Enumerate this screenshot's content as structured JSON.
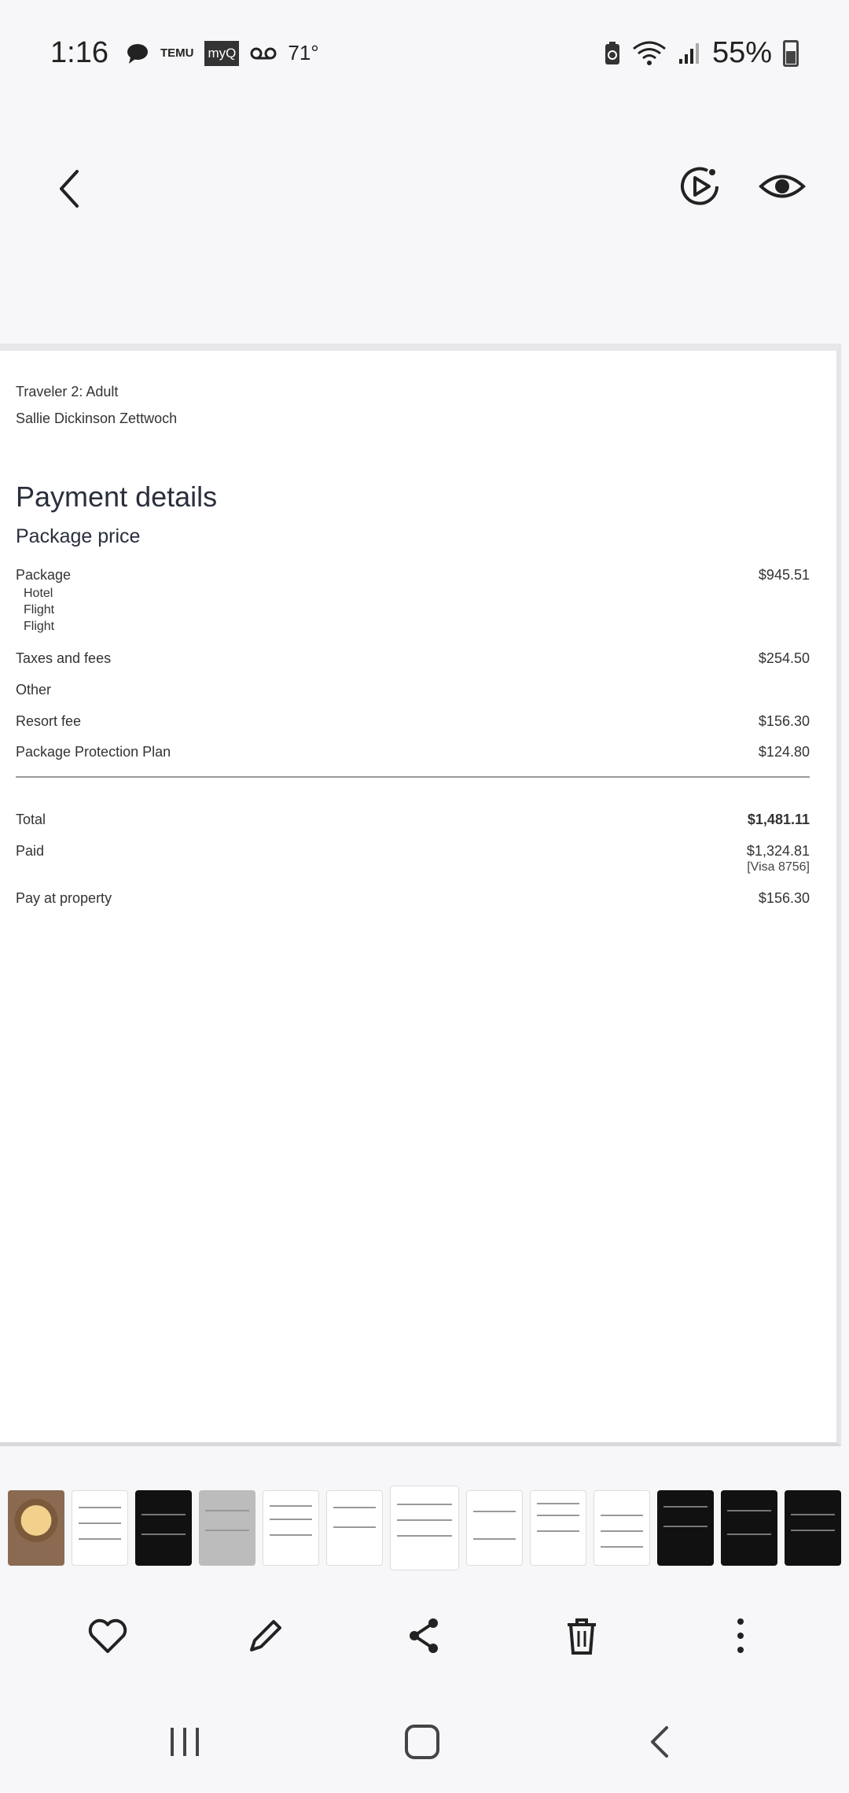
{
  "status_bar": {
    "time": "1:16",
    "temu_label": "TEMU",
    "myq_label": "myQ",
    "temperature": "71°",
    "battery_percent": "55%"
  },
  "document": {
    "traveler_heading": "Traveler 2: Adult",
    "traveler_name": "Sallie Dickinson Zettwoch",
    "payment_title": "Payment details",
    "package_title": "Package price",
    "package": {
      "label": "Package",
      "amount": "$945.51",
      "items": [
        "Hotel",
        "Flight",
        "Flight"
      ]
    },
    "taxes": {
      "label": "Taxes and fees",
      "amount": "$254.50"
    },
    "other": {
      "label": "Other"
    },
    "resort_fee": {
      "label": "Resort fee",
      "amount": "$156.30"
    },
    "protection": {
      "label": "Package Protection Plan",
      "amount": "$124.80"
    },
    "total": {
      "label": "Total",
      "amount": "$1,481.11"
    },
    "paid": {
      "label": "Paid",
      "amount": "$1,324.81",
      "card": "[Visa 8756]"
    },
    "pay_at_property": {
      "label": "Pay at property",
      "amount": "$156.30"
    }
  },
  "thumbnails": [
    "photo",
    "light",
    "dark",
    "gray",
    "light",
    "light",
    "light-selected",
    "light",
    "light",
    "light",
    "dark",
    "dark",
    "dark"
  ],
  "actions": [
    "heart-icon",
    "pencil-icon",
    "share-icon",
    "trash-icon",
    "more-vertical-icon"
  ],
  "nav": [
    "recent-apps-icon",
    "home-icon",
    "back-icon"
  ]
}
